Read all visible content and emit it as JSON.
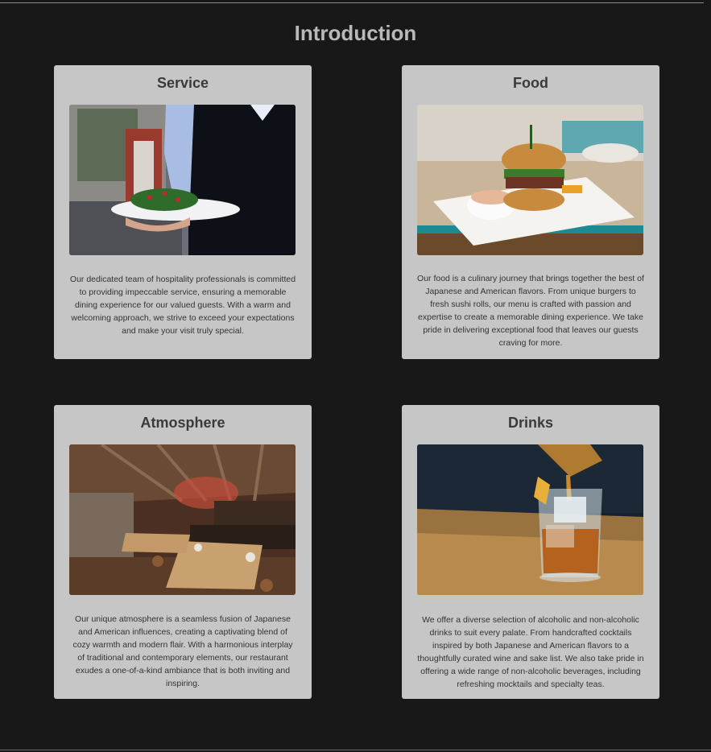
{
  "page": {
    "title": "Introduction"
  },
  "cards": [
    {
      "title": "Service",
      "image": "waiter-serving-salad-photo",
      "text": "Our dedicated team of hospitality professionals is committed to providing impeccable service, ensuring a memorable dining experience for our valued guests. With a warm and welcoming approach, we strive to exceed your expectations and make your visit truly special."
    },
    {
      "title": "Food",
      "image": "burger-plate-photo",
      "text": "Our food is a culinary journey that brings together the best of Japanese and American flavors. From unique burgers to fresh sushi rolls, our menu is crafted with passion and expertise to create a memorable dining experience. We take pride in delivering exceptional food that leaves our guests craving for more."
    },
    {
      "title": "Atmosphere",
      "image": "restaurant-interior-photo",
      "text": "Our unique atmosphere is a seamless fusion of Japanese and American influences, creating a captivating blend of cozy warmth and modern flair. With a harmonious interplay of traditional and contemporary elements, our restaurant exudes a one-of-a-kind ambiance that is both inviting and inspiring."
    },
    {
      "title": "Drinks",
      "image": "cocktail-pour-photo",
      "text": "We offer a diverse selection of alcoholic and non-alcoholic drinks to suit every palate. From handcrafted cocktails inspired by both Japanese and American flavors to a thoughtfully curated wine and sake list. We also take pride in offering a wide range of non-alcoholic beverages, including refreshing mocktails and specialty teas."
    }
  ],
  "colors": {
    "background": "#181818",
    "card": "#c6c6c6",
    "heading": "#b9b9b9",
    "card_title": "#3a3a3a",
    "text": "#333333"
  }
}
